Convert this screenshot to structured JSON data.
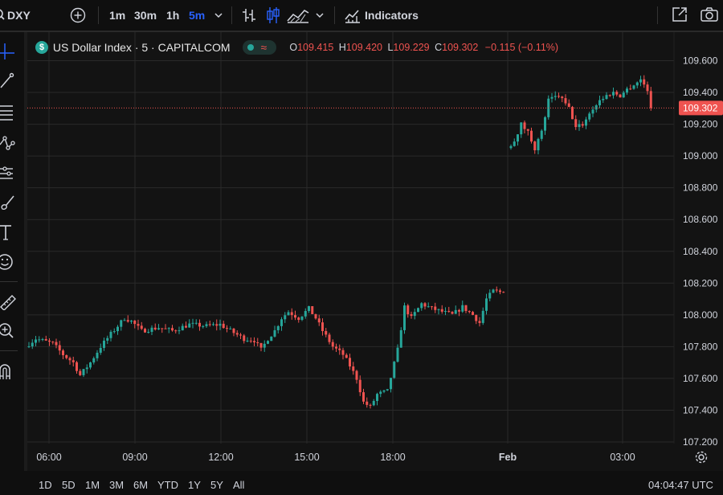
{
  "toolbar": {
    "symbol": "DXY",
    "intervals": [
      "1m",
      "30m",
      "1h",
      "5m"
    ],
    "active_interval": "5m",
    "indicators_label": "Indicators",
    "icons": [
      "search-icon",
      "add-symbol-icon",
      "interval-dropdown-icon",
      "bar-style-icon",
      "candles-icon",
      "area-style-icon",
      "chart-type-dropdown-icon",
      "indicators-icon",
      "fullscreen-icon",
      "camera-icon"
    ]
  },
  "left_tools": [
    "crosshair-icon",
    "trend-line-icon",
    "fib-retracement-icon",
    "pattern-icon",
    "prediction-icon",
    "brush-icon",
    "text-icon",
    "emoji-icon",
    "ruler-icon",
    "zoom-in-icon",
    "magnet-icon"
  ],
  "legend": {
    "title": "US Dollar Index · 5 · CAPITALCOM",
    "o_label": "O",
    "o": "109.415",
    "h_label": "H",
    "h": "109.420",
    "l_label": "L",
    "l": "109.229",
    "c_label": "C",
    "c": "109.302",
    "change": "−0.115 (−0.11%)",
    "wave_glyph": "≈"
  },
  "colors": {
    "up": "#26a69a",
    "down": "#ef5350",
    "grid": "#2a2a2a",
    "text": "#d1d4dc",
    "accent": "#2962ff"
  },
  "chart_data": {
    "type": "candlestick",
    "y_ticks": [
      "109.600",
      "109.400",
      "109.200",
      "109.000",
      "108.800",
      "108.600",
      "108.400",
      "108.200",
      "108.000",
      "107.800",
      "107.600",
      "107.400",
      "107.200"
    ],
    "ylim": [
      107.2,
      109.6
    ],
    "x_ticks": [
      "06:00",
      "09:00",
      "12:00",
      "15:00",
      "18:00",
      "Feb",
      "03:00"
    ],
    "last_price": "109.302",
    "path_day1": [
      [
        0,
        107.8
      ],
      [
        3,
        107.85
      ],
      [
        8,
        107.82
      ],
      [
        11,
        107.75
      ],
      [
        14,
        107.7
      ],
      [
        16,
        107.62
      ],
      [
        19,
        107.7
      ],
      [
        22,
        107.8
      ],
      [
        25,
        107.88
      ],
      [
        29,
        107.98
      ],
      [
        31,
        107.96
      ],
      [
        34,
        107.9
      ],
      [
        39,
        107.92
      ],
      [
        43,
        107.9
      ],
      [
        48,
        107.94
      ],
      [
        53,
        107.93
      ],
      [
        57,
        107.94
      ],
      [
        60,
        107.9
      ],
      [
        64,
        107.85
      ],
      [
        67,
        107.84
      ],
      [
        69,
        107.78
      ],
      [
        71,
        107.85
      ],
      [
        73,
        107.9
      ],
      [
        75,
        107.98
      ],
      [
        77,
        108.02
      ],
      [
        80,
        107.98
      ],
      [
        83,
        108.04
      ],
      [
        85,
        107.98
      ],
      [
        87,
        107.9
      ],
      [
        90,
        107.8
      ],
      [
        93,
        107.75
      ],
      [
        95,
        107.68
      ],
      [
        97,
        107.6
      ],
      [
        99,
        107.45
      ],
      [
        101,
        107.42
      ],
      [
        103,
        107.5
      ],
      [
        106,
        107.52
      ],
      [
        109,
        107.78
      ],
      [
        111,
        108.05
      ],
      [
        113,
        107.98
      ],
      [
        116,
        108.07
      ],
      [
        119,
        108.04
      ],
      [
        122,
        108.02
      ],
      [
        125,
        108.0
      ],
      [
        128,
        108.05
      ],
      [
        131,
        108.0
      ],
      [
        133,
        107.95
      ],
      [
        135,
        108.1
      ],
      [
        137,
        108.15
      ],
      [
        140,
        108.14
      ]
    ],
    "path_day2": [
      [
        0,
        109.05
      ],
      [
        2,
        109.1
      ],
      [
        4,
        109.2
      ],
      [
        6,
        109.15
      ],
      [
        8,
        109.05
      ],
      [
        10,
        109.15
      ],
      [
        12,
        109.35
      ],
      [
        15,
        109.38
      ],
      [
        18,
        109.3
      ],
      [
        20,
        109.18
      ],
      [
        22,
        109.2
      ],
      [
        25,
        109.3
      ],
      [
        27,
        109.35
      ],
      [
        29,
        109.38
      ],
      [
        31,
        109.4
      ],
      [
        33,
        109.38
      ],
      [
        35,
        109.42
      ],
      [
        37,
        109.45
      ],
      [
        39,
        109.48
      ],
      [
        41,
        109.42
      ],
      [
        42,
        109.302
      ]
    ]
  },
  "bottom": {
    "ranges": [
      "1D",
      "5D",
      "1M",
      "3M",
      "6M",
      "YTD",
      "1Y",
      "5Y",
      "All"
    ],
    "time": "04:04:47 UTC"
  }
}
